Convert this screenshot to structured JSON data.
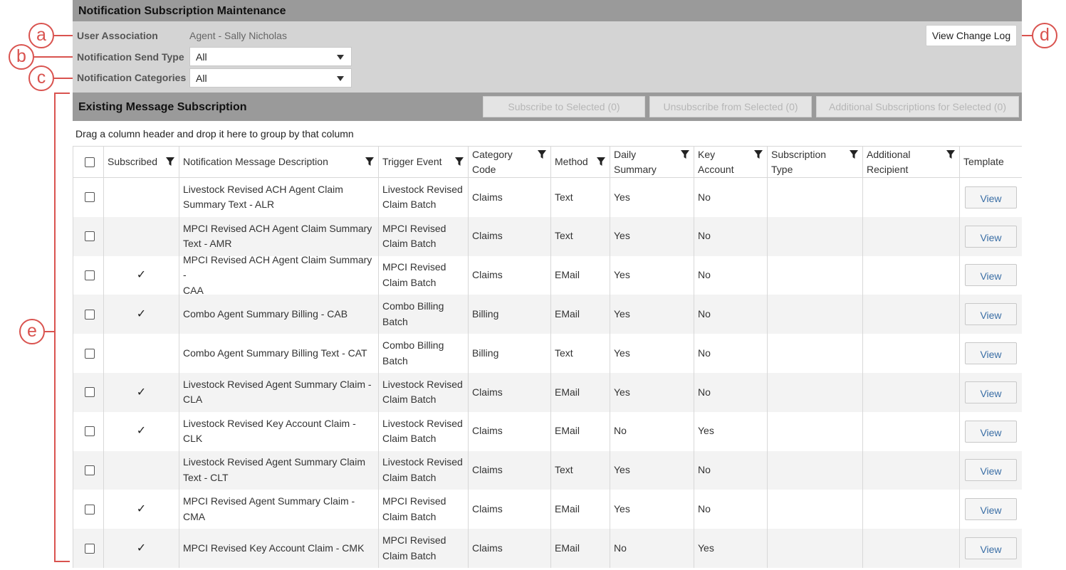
{
  "header": {
    "title": "Notification Subscription Maintenance"
  },
  "filters": {
    "user_association_label": "User Association",
    "user_association_value": "Agent - Sally Nicholas",
    "send_type_label": "Notification Send Type",
    "send_type_value": "All",
    "categories_label": "Notification Categories",
    "categories_value": "All",
    "view_change_log": "View Change Log"
  },
  "subscription_bar": {
    "title": "Existing Message Subscription",
    "subscribe_btn": "Subscribe to Selected (0)",
    "unsubscribe_btn": "Unsubscribe from Selected (0)",
    "additional_btn": "Additional Subscriptions for Selected (0)"
  },
  "group_hint": "Drag a column header and drop it here to group by that column",
  "grid": {
    "columns": {
      "subscribed": "Subscribed",
      "description": "Notification Message Description",
      "trigger": "Trigger Event",
      "category_line1": "Category",
      "category_line2": "Code",
      "method": "Method",
      "daily_line1": "Daily",
      "daily_line2": "Summary",
      "key_line1": "Key",
      "key_line2": "Account",
      "subtype_line1": "Subscription",
      "subtype_line2": "Type",
      "addl_line1": "Additional",
      "addl_line2": "Recipient",
      "template": "Template"
    },
    "view_label": "View",
    "rows": [
      {
        "subscribed": "",
        "desc1": "Livestock Revised ACH Agent Claim",
        "desc2": "Summary Text - ALR",
        "trig1": "Livestock Revised",
        "trig2": "Claim Batch",
        "category": "Claims",
        "method": "Text",
        "daily": "Yes",
        "key": "No"
      },
      {
        "subscribed": "",
        "desc1": "MPCI Revised ACH Agent Claim Summary",
        "desc2": "Text - AMR",
        "trig1": "MPCI Revised",
        "trig2": "Claim Batch",
        "category": "Claims",
        "method": "Text",
        "daily": "Yes",
        "key": "No"
      },
      {
        "subscribed": "✓",
        "desc1": "MPCI Revised ACH Agent Claim Summary -",
        "desc2": "CAA",
        "trig1": "MPCI Revised",
        "trig2": "Claim Batch",
        "category": "Claims",
        "method": "EMail",
        "daily": "Yes",
        "key": "No"
      },
      {
        "subscribed": "✓",
        "desc1": "Combo Agent Summary Billing - CAB",
        "desc2": "",
        "trig1": "Combo Billing",
        "trig2": "Batch",
        "category": "Billing",
        "method": "EMail",
        "daily": "Yes",
        "key": "No"
      },
      {
        "subscribed": "",
        "desc1": "Combo Agent Summary Billing Text - CAT",
        "desc2": "",
        "trig1": "Combo Billing",
        "trig2": "Batch",
        "category": "Billing",
        "method": "Text",
        "daily": "Yes",
        "key": "No"
      },
      {
        "subscribed": "✓",
        "desc1": "Livestock Revised Agent Summary Claim -",
        "desc2": "CLA",
        "trig1": "Livestock Revised",
        "trig2": "Claim Batch",
        "category": "Claims",
        "method": "EMail",
        "daily": "Yes",
        "key": "No"
      },
      {
        "subscribed": "✓",
        "desc1": "Livestock Revised Key Account Claim - CLK",
        "desc2": "",
        "trig1": "Livestock Revised",
        "trig2": "Claim Batch",
        "category": "Claims",
        "method": "EMail",
        "daily": "No",
        "key": "Yes"
      },
      {
        "subscribed": "",
        "desc1": "Livestock Revised Agent Summary Claim",
        "desc2": "Text - CLT",
        "trig1": "Livestock Revised",
        "trig2": "Claim Batch",
        "category": "Claims",
        "method": "Text",
        "daily": "Yes",
        "key": "No"
      },
      {
        "subscribed": "✓",
        "desc1": "MPCI Revised Agent Summary Claim -",
        "desc2": "CMA",
        "trig1": "MPCI Revised",
        "trig2": "Claim Batch",
        "category": "Claims",
        "method": "EMail",
        "daily": "Yes",
        "key": "No"
      },
      {
        "subscribed": "✓",
        "desc1": "MPCI Revised Key Account Claim - CMK",
        "desc2": "",
        "trig1": "MPCI Revised",
        "trig2": "Claim Batch",
        "category": "Claims",
        "method": "EMail",
        "daily": "No",
        "key": "Yes"
      }
    ]
  },
  "callouts": {
    "a": "a",
    "b": "b",
    "c": "c",
    "d": "d",
    "e": "e"
  },
  "colors": {
    "callout": "#d9534f",
    "header_bar": "#9a9a9a",
    "filter_bg": "#d4d4d4",
    "link": "#3a6ea5"
  }
}
